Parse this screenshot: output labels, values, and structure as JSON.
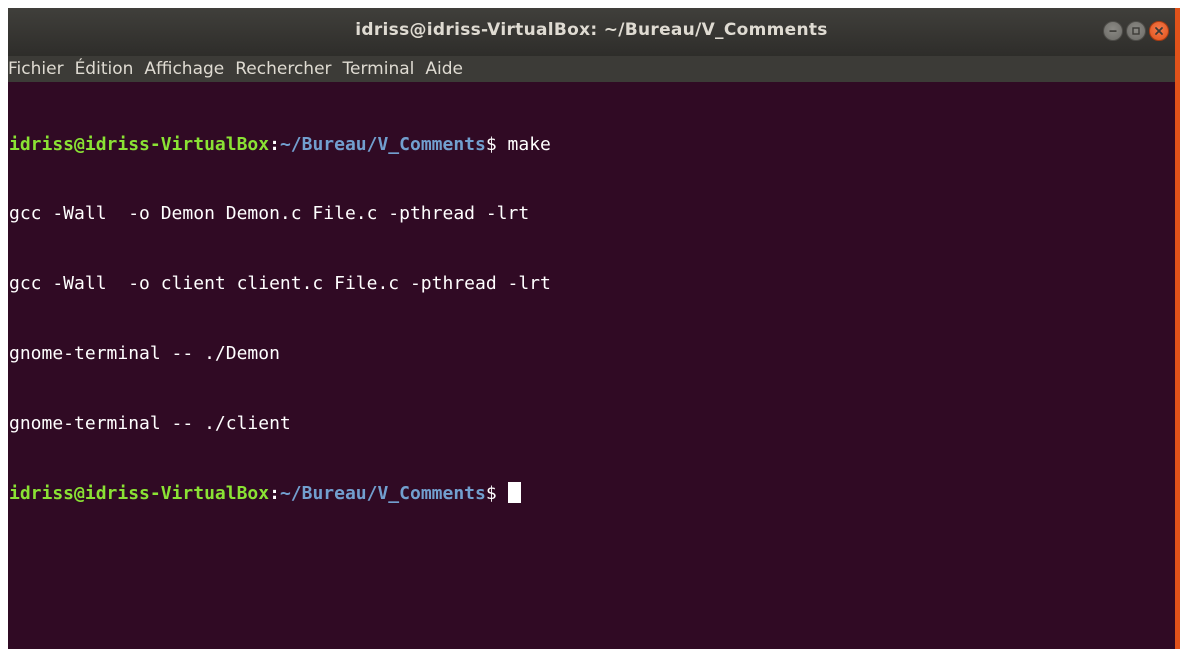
{
  "window": {
    "title": "idriss@idriss-VirtualBox: ~/Bureau/V_Comments",
    "controls": [
      "minimize-icon",
      "maximize-icon",
      "close-icon"
    ]
  },
  "menu": {
    "items": [
      {
        "label": "Fichier"
      },
      {
        "label": "Édition"
      },
      {
        "label": "Affichage"
      },
      {
        "label": "Rechercher"
      },
      {
        "label": "Terminal"
      },
      {
        "label": "Aide"
      }
    ]
  },
  "terminal": {
    "prompt_user": "idriss@idriss-VirtualBox",
    "prompt_sep": ":",
    "prompt_path": "~/Bureau/V_Comments",
    "prompt_symbol": "$ ",
    "first_command": "make",
    "output_lines": [
      "gcc -Wall  -o Demon Demon.c File.c -pthread -lrt",
      "gcc -Wall  -o client client.c File.c -pthread -lrt",
      "gnome-terminal -- ./Demon",
      "gnome-terminal -- ./client"
    ]
  },
  "colors": {
    "background": "#300a24",
    "prompt_user": "#8ae234",
    "prompt_path": "#729fcf",
    "accent": "#e0521a"
  }
}
